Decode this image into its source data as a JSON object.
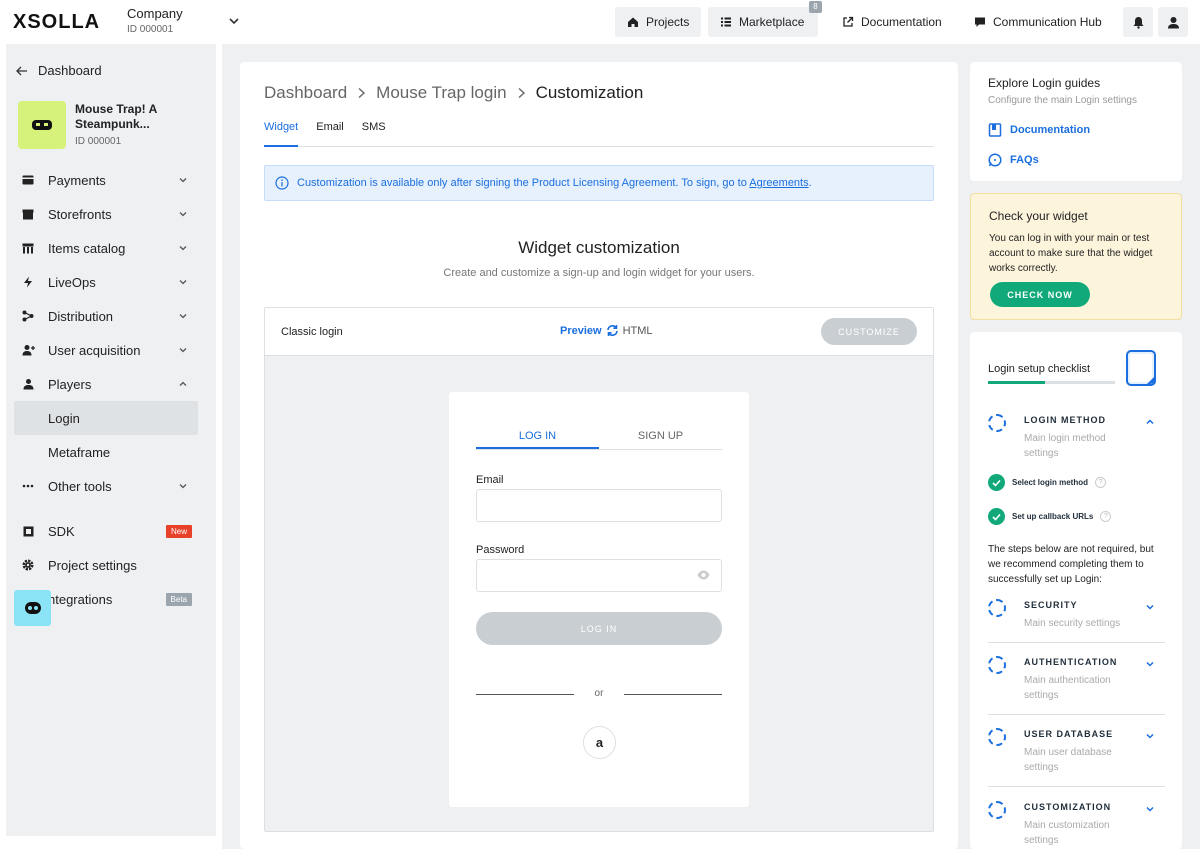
{
  "topbar": {
    "logo_text": "XSOLLA",
    "company_name": "Company",
    "company_id": "ID 000001",
    "projects_label": "Projects",
    "marketplace_label": "Marketplace",
    "marketplace_badge": "8",
    "documentation_label": "Documentation",
    "communication_label": "Communication Hub"
  },
  "sidebar": {
    "back_label": "Dashboard",
    "project_title": "Mouse Trap! A Steampunk...",
    "project_id": "ID 000001",
    "items": [
      {
        "label": "Payments"
      },
      {
        "label": "Storefronts"
      },
      {
        "label": "Items catalog"
      },
      {
        "label": "LiveOps"
      },
      {
        "label": "Distribution"
      },
      {
        "label": "User acquisition"
      },
      {
        "label": "Players"
      },
      {
        "label": "Login"
      },
      {
        "label": "Metaframe"
      },
      {
        "label": "Other tools"
      },
      {
        "label": "SDK",
        "tag": "New"
      },
      {
        "label": "Project settings"
      },
      {
        "label": "ntegrations",
        "tag": "Beta"
      }
    ]
  },
  "main": {
    "breadcrumb": [
      "Dashboard",
      "Mouse Trap login",
      "Customization"
    ],
    "tabs": [
      "Widget",
      "Email",
      "SMS"
    ],
    "info_text": "Customization is available only after signing the Product Licensing Agreement. To sign, go to ",
    "info_link": "Agreements",
    "info_end": ".",
    "title": "Widget customization",
    "subtitle": "Create and customize a sign-up and login widget for your users.",
    "classic_login": "Classic login",
    "preview_label": "Preview",
    "html_label": "HTML",
    "customize_label": "CUSTOMIZE",
    "widget": {
      "tab_login": "LOG IN",
      "tab_signup": "SIGN UP",
      "email_label": "Email",
      "password_label": "Password",
      "login_button": "LOG IN",
      "or_text": "or",
      "social_icon": "amazon-icon",
      "social_glyph": "a"
    }
  },
  "right": {
    "guides_title": "Explore Login guides",
    "guides_sub": "Configure the main Login settings",
    "doc_link": "Documentation",
    "faq_link": "FAQs",
    "check_title": "Check your widget",
    "check_text": "You can log in with your main or test account to make sure that the widget works correctly.",
    "check_button": "CHECK NOW",
    "checklist_title": "Login setup checklist",
    "checklist_progress": 0.45,
    "sections": [
      {
        "title": "LOGIN METHOD",
        "desc": "Main login method settings"
      },
      {
        "title": "SECURITY",
        "desc": "Main security settings"
      },
      {
        "title": "AUTHENTICATION",
        "desc": "Main authentication settings"
      },
      {
        "title": "USER DATABASE",
        "desc": "Main user database settings"
      },
      {
        "title": "CUSTOMIZATION",
        "desc": "Main customization settings"
      }
    ],
    "steps": [
      "Select login method",
      "Set up callback URLs"
    ],
    "note": "The steps below are not required, but we recommend completing them to successfully set up Login:"
  },
  "colors": {
    "accent": "#1a6ede",
    "success": "#11a97a",
    "project_tile": "#d6f27a"
  }
}
